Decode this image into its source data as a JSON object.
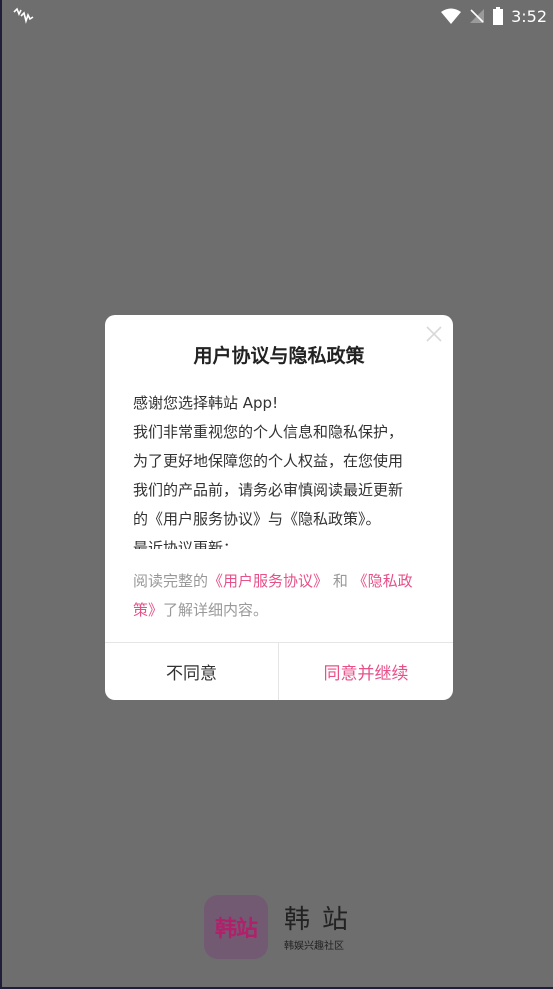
{
  "status_bar": {
    "time": "3:52",
    "icons": [
      "activity-icon",
      "wifi-icon",
      "signal-off-icon",
      "battery-icon"
    ]
  },
  "dialog": {
    "title": "用户协议与隐私政策",
    "body_lines": [
      "感谢您选择韩站 App!",
      "我们非常重视您的个人信息和隐私保护，",
      "为了更好地保障您的个人权益，在您使用",
      "我们的产品前，请务必审慎阅读最近更新",
      "的《用户服务协议》与《隐私政策》。",
      "最近协议更新："
    ],
    "footer": {
      "prefix": "阅读完整的",
      "link1": "《用户服务协议》",
      "middle": "和",
      "link2": "《隐私政策》",
      "suffix": "了解详细内容。"
    },
    "disagree_label": "不同意",
    "agree_label": "同意并继续"
  },
  "brand": {
    "logo_text": "韩站",
    "name": "韩站",
    "subtitle": "韩娱兴趣社区"
  },
  "colors": {
    "accent": "#e8508a",
    "overlay": "#6e6e6e",
    "logo_bg": "#735a73"
  }
}
